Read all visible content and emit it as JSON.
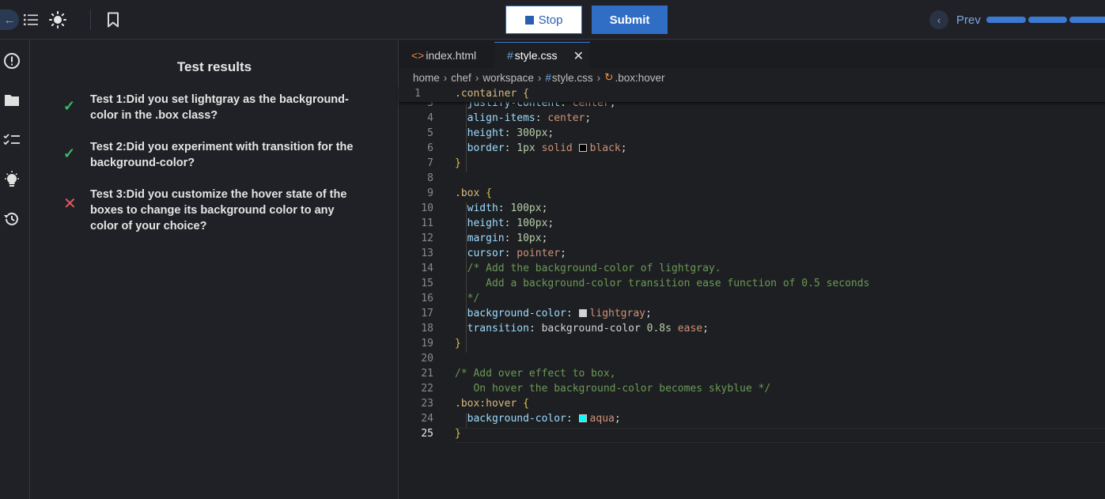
{
  "topbar": {
    "stop_label": "Stop",
    "submit_label": "Submit",
    "prev_label": "Prev",
    "progress_segments": 3
  },
  "tests": {
    "title": "Test results",
    "items": [
      {
        "status": "pass",
        "text": "Test 1:Did you set lightgray as the background-color in the .box class?"
      },
      {
        "status": "pass",
        "text": "Test 2:Did you experiment with transition for the background-color?"
      },
      {
        "status": "fail",
        "text": "Test 3:Did you customize the hover state of the boxes to change its background color to any color of your choice?"
      }
    ]
  },
  "editor": {
    "tabs": [
      {
        "label": "index.html"
      },
      {
        "label": "style.css"
      }
    ],
    "breadcrumb": [
      "home",
      "chef",
      "workspace",
      "style.css",
      ".box:hover"
    ],
    "sticky": {
      "line": "1",
      "text": ".container {"
    },
    "lines": [
      {
        "n": "3",
        "text": "  justify-content: center;"
      },
      {
        "n": "4",
        "text": "  align-items: center;"
      },
      {
        "n": "5",
        "text": "  height: 300px;"
      },
      {
        "n": "6",
        "text": "  border: 1px solid black;"
      },
      {
        "n": "7",
        "text": "}"
      },
      {
        "n": "8",
        "text": ""
      },
      {
        "n": "9",
        "text": ".box {"
      },
      {
        "n": "10",
        "text": "  width: 100px;"
      },
      {
        "n": "11",
        "text": "  height: 100px;"
      },
      {
        "n": "12",
        "text": "  margin: 10px;"
      },
      {
        "n": "13",
        "text": "  cursor: pointer;"
      },
      {
        "n": "14",
        "text": "  /* Add the background-color of lightgray."
      },
      {
        "n": "15",
        "text": "     Add a background-color transition ease function of 0.5 seconds"
      },
      {
        "n": "16",
        "text": "  */"
      },
      {
        "n": "17",
        "text": "  background-color: lightgray;"
      },
      {
        "n": "18",
        "text": "  transition: background-color 0.8s ease;"
      },
      {
        "n": "19",
        "text": "}"
      },
      {
        "n": "20",
        "text": ""
      },
      {
        "n": "21",
        "text": "/* Add over effect to box,"
      },
      {
        "n": "22",
        "text": "   On hover the background-color becomes skyblue */"
      },
      {
        "n": "23",
        "text": ".box:hover {"
      },
      {
        "n": "24",
        "text": "  background-color: aqua;"
      },
      {
        "n": "25",
        "text": "}"
      }
    ],
    "current_line": "25",
    "swatches": {
      "black": "#000000",
      "lightgray": "#d3d3d3",
      "aqua": "#00ffff"
    }
  },
  "colors": {
    "accent": "#2f6ec4",
    "pass": "#3dbb62",
    "fail": "#e25c5c"
  }
}
